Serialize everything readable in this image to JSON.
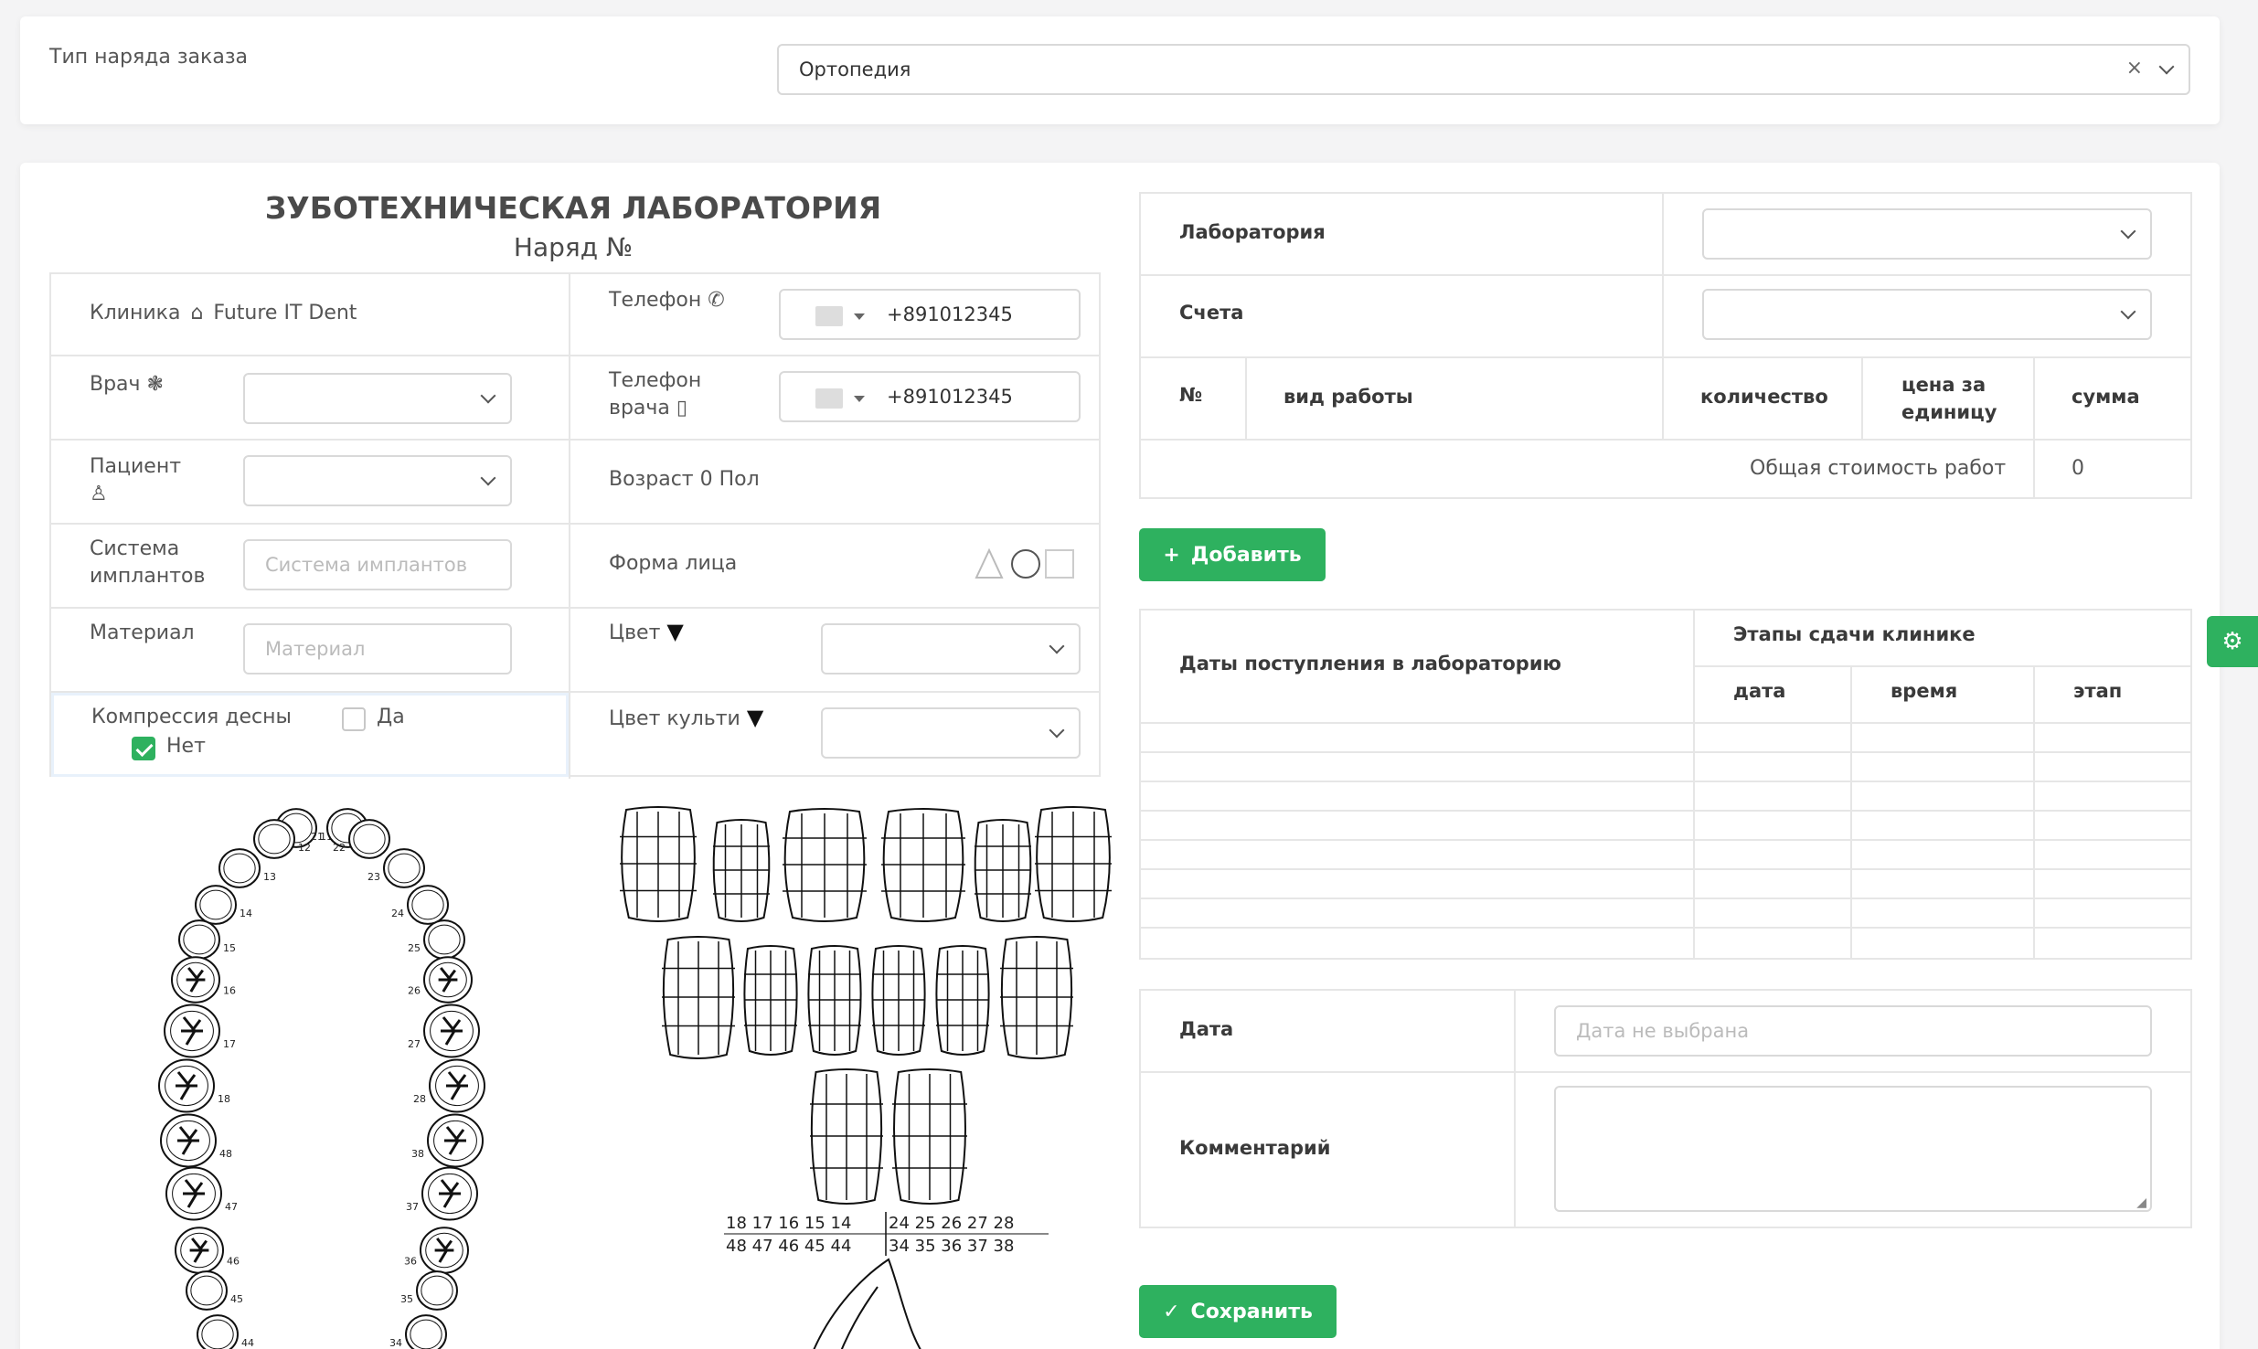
{
  "order_type": {
    "label": "Тип наряда заказа",
    "value": "Ортопедия"
  },
  "form": {
    "lab_title": "ЗУБОТЕХНИЧЕСКАЯ ЛАБОРАТОРИЯ",
    "order_no": "Наряд №",
    "clinic_label": "Клиника",
    "clinic_value": "Future IT Dent",
    "phone_label": "Телефон",
    "phone_value": "+891012345",
    "doctor_label": "Врач",
    "doctor_phone_label_1": "Телефон",
    "doctor_phone_label_2": "врача",
    "doctor_phone_value": "+891012345",
    "patient_label": "Пациент",
    "age_gender": "Возраст 0 Пол",
    "implant_label_1": "Система",
    "implant_label_2": "имплантов",
    "implant_placeholder": "Система имплантов",
    "face_shape_label": "Форма лица",
    "material_label": "Материал",
    "material_placeholder": "Материал",
    "color_label": "Цвет",
    "gum_compression_label": "Компрессия десны",
    "yes_label": "Да",
    "no_label": "Нет",
    "stump_color_label": "Цвет культи"
  },
  "right": {
    "lab_label": "Лаборатория",
    "accounts_label": "Счета",
    "table_headers": {
      "no": "№",
      "work_type": "вид работы",
      "qty": "количество",
      "price_1": "цена за",
      "price_2": "единицу",
      "sum": "сумма"
    },
    "total_label": "Общая стоимость работ",
    "total_value": "0",
    "add_button": "Добавить",
    "dates_header": "Даты поступления в лабораторию",
    "stages_header": "Этапы сдачи клинике",
    "stage_cols": {
      "date": "дата",
      "time": "время",
      "stage": "этап"
    },
    "date_label": "Дата",
    "date_placeholder": "Дата не выбрана",
    "comment_label": "Комментарий",
    "save_button": "Сохранить"
  },
  "tooth_numbers": {
    "upper_row": "18 17 16 15 14",
    "upper_row_right": "24 25 26 27 28",
    "lower_row": "48 47 46 45 44",
    "lower_row_right": "34 35 36 37 38",
    "left_arch": [
      "11",
      "12",
      "13",
      "14",
      "15",
      "16",
      "17",
      "18",
      "48",
      "47",
      "46",
      "45",
      "44"
    ],
    "right_arch": [
      "21",
      "22",
      "23",
      "24",
      "25",
      "26",
      "27",
      "28",
      "38",
      "37",
      "36",
      "35",
      "34"
    ]
  },
  "colors": {
    "accent": "#2eb15f"
  }
}
